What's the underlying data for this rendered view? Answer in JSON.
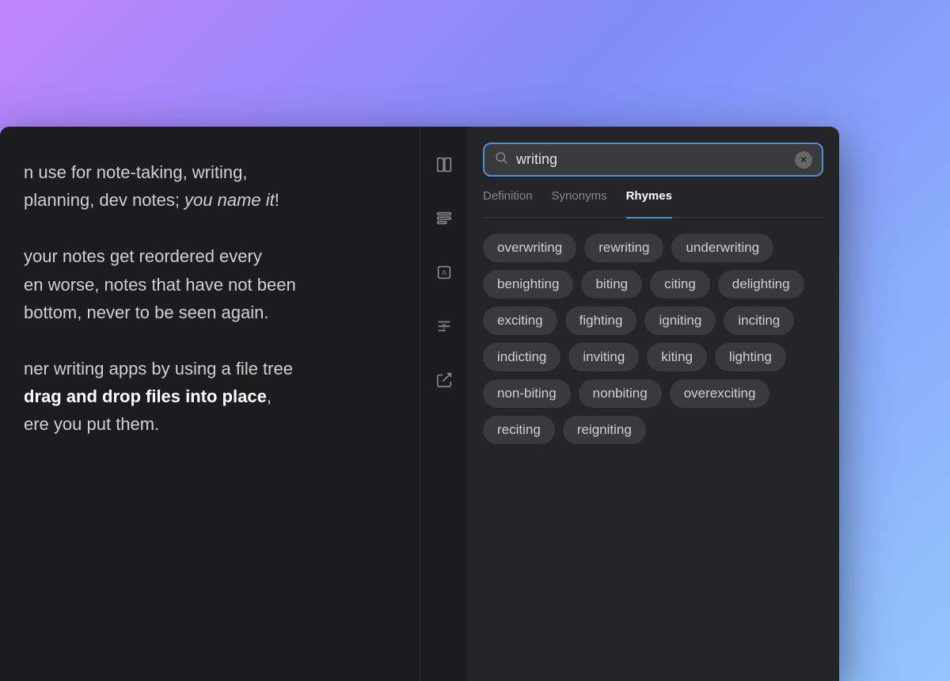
{
  "background": {
    "gradient": "linear-gradient(135deg, #c084fc 0%, #818cf8 40%, #93c5fd 100%)"
  },
  "editor": {
    "paragraphs": [
      "n use for note-taking, writing, planning, dev notes; you name it!",
      "your notes get reordered every en worse, notes that have not been bottom, never to be seen again.",
      "ner writing apps by using a file tree drag and drop files into place, ere you put them."
    ],
    "italic_phrase": "you name it",
    "bold_phrase": "drag and drop files into place"
  },
  "sidebar_icons": [
    {
      "name": "book-icon",
      "glyph": "⊟"
    },
    {
      "name": "list-icon",
      "glyph": "≡"
    },
    {
      "name": "font-icon",
      "glyph": "A"
    },
    {
      "name": "text-icon",
      "glyph": "T"
    },
    {
      "name": "share-icon",
      "glyph": "⬆"
    }
  ],
  "dictionary": {
    "search": {
      "placeholder": "writing",
      "value": "writing",
      "clear_label": "×"
    },
    "tabs": [
      {
        "id": "definition",
        "label": "Definition",
        "active": false
      },
      {
        "id": "synonyms",
        "label": "Synonyms",
        "active": false
      },
      {
        "id": "rhymes",
        "label": "Rhymes",
        "active": true
      }
    ],
    "rhymes": [
      "overwriting",
      "rewriting",
      "underwriting",
      "benighting",
      "biting",
      "citing",
      "delighting",
      "exciting",
      "fighting",
      "igniting",
      "inciting",
      "indicting",
      "inviting",
      "kiting",
      "lighting",
      "non-biting",
      "nonbiting",
      "overexciting",
      "reciting",
      "reigniting"
    ]
  }
}
